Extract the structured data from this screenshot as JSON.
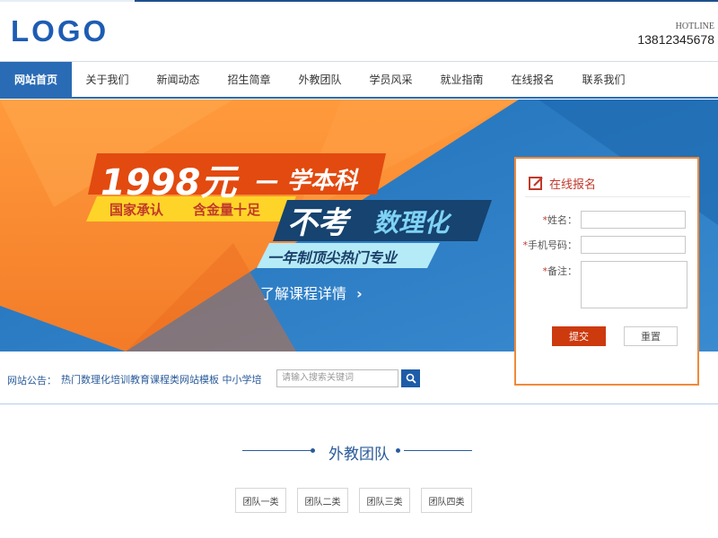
{
  "header": {
    "logo_text": "LOGO",
    "hotline_label": "HOTLINE",
    "hotline_number": "13812345678"
  },
  "nav": {
    "items": [
      {
        "label": "网站首页",
        "active": true
      },
      {
        "label": "关于我们"
      },
      {
        "label": "新闻动态"
      },
      {
        "label": "招生简章"
      },
      {
        "label": "外教团队"
      },
      {
        "label": "学员风采"
      },
      {
        "label": "就业指南"
      },
      {
        "label": "在线报名"
      },
      {
        "label": "联系我们"
      }
    ]
  },
  "banner": {
    "price": "1998元",
    "headline": "— 学本科",
    "tag_left": "国家承认",
    "tag_right": "含金量十足",
    "big_text_1": "不考",
    "big_text_2": "数理化",
    "sub_text": "一年制顶尖热门专业",
    "cta": "了解课程详情"
  },
  "form": {
    "title": "在线报名",
    "fields": [
      {
        "label": "姓名：",
        "required": true
      },
      {
        "label": "手机号码：",
        "required": true
      },
      {
        "label": "备注：",
        "required": true
      }
    ],
    "required_mark": "*",
    "submit_label": "提交",
    "reset_label": "重置"
  },
  "notice": {
    "label": "网站公告：",
    "text": "热门数理化培训教育课程类网站模板 中小学培"
  },
  "search": {
    "placeholder": "请输入搜索关键词"
  },
  "section": {
    "title": "外教团队",
    "tabs": [
      "团队一类",
      "团队二类",
      "团队三类",
      "团队四类"
    ]
  },
  "colors": {
    "brand_blue": "#2a6bb5",
    "accent_orange": "#f08a3a",
    "submit_red": "#cc3a0e"
  }
}
